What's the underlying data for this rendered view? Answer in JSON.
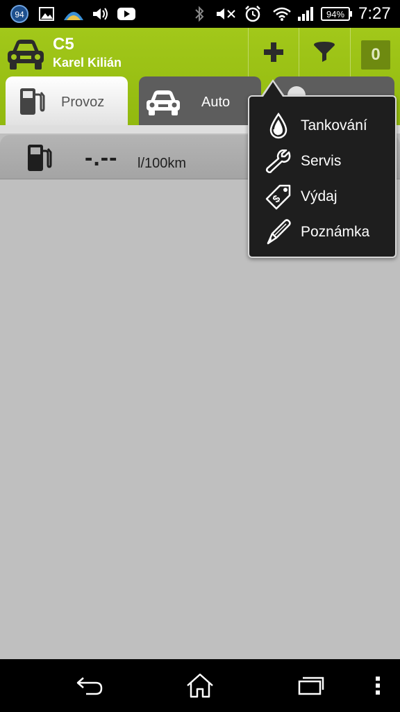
{
  "status_bar": {
    "notification_badge": "94",
    "battery_percent": "94%",
    "time": "7:27",
    "icons": [
      "badge-94-icon",
      "gallery-icon",
      "weather-icon",
      "volume-icon",
      "youtube-icon",
      "bluetooth-icon",
      "mute-icon",
      "alarm-icon",
      "wifi-icon",
      "signal-icon",
      "battery-icon"
    ]
  },
  "action_bar": {
    "title": "C5",
    "subtitle": "Karel Kilián",
    "count": "0",
    "accent": "#9bc214"
  },
  "tabs": [
    {
      "label": "Provoz",
      "active": true
    },
    {
      "label": "Auto",
      "active": false
    },
    {
      "label": "",
      "active": false
    }
  ],
  "consumption": {
    "value": "-.--",
    "unit": "l/100km"
  },
  "popup_menu": {
    "items": [
      {
        "label": "Tankování",
        "icon": "fuel-drop-icon"
      },
      {
        "label": "Servis",
        "icon": "wrench-icon"
      },
      {
        "label": "Výdaj",
        "icon": "expense-tag-icon"
      },
      {
        "label": "Poznámka",
        "icon": "pencil-icon"
      }
    ]
  },
  "nav_bar": {
    "icons": [
      "back-icon",
      "home-icon",
      "recent-apps-icon",
      "overflow-menu-icon"
    ]
  }
}
